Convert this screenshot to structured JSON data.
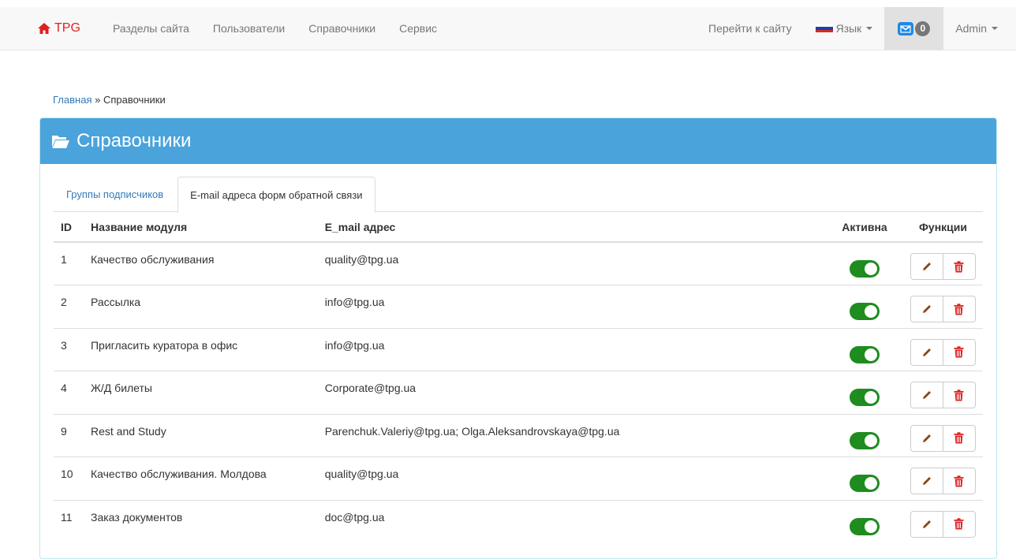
{
  "nav": {
    "brand": "TPG",
    "left_items": [
      "Разделы сайта",
      "Пользователи",
      "Справочники",
      "Сервис"
    ],
    "goto_site": "Перейти к сайту",
    "language": "Язык",
    "messages_count": "0",
    "user": "Admin"
  },
  "breadcrumb": {
    "home": "Главная",
    "separator": "»",
    "current": "Справочники"
  },
  "panel": {
    "title": "Справочники"
  },
  "tabs": [
    {
      "label": "Группы подписчиков",
      "active": false
    },
    {
      "label": "E-mail адреса форм обратной связи",
      "active": true
    }
  ],
  "table": {
    "headers": {
      "id": "ID",
      "module": "Название модуля",
      "email": "E_mail адрес",
      "active": "Активна",
      "functions": "Функции"
    },
    "rows": [
      {
        "id": "1",
        "module": "Качество обслуживания",
        "email": "quality@tpg.ua",
        "active": true
      },
      {
        "id": "2",
        "module": "Рассылка",
        "email": "info@tpg.ua",
        "active": true
      },
      {
        "id": "3",
        "module": "Пригласить куратора в офис",
        "email": "info@tpg.ua",
        "active": true
      },
      {
        "id": "4",
        "module": "Ж/Д билеты",
        "email": "Corporate@tpg.ua",
        "active": true
      },
      {
        "id": "9",
        "module": "Rest and Study",
        "email": "Parenchuk.Valeriy@tpg.ua; Olga.Aleksandrovskaya@tpg.ua",
        "active": true
      },
      {
        "id": "10",
        "module": "Качество обслуживания. Молдова",
        "email": "quality@tpg.ua",
        "active": true
      },
      {
        "id": "11",
        "module": "Заказ документов",
        "email": "doc@tpg.ua",
        "active": true
      }
    ]
  },
  "icons": {
    "brand": "home-icon",
    "panel": "folder-open-icon",
    "messages": "envelope-icon",
    "edit": "pencil-icon",
    "delete": "trash-icon"
  },
  "colors": {
    "brand": "#e02020",
    "panel_heading": "#4aa3db",
    "toggle_on": "#1e8c1e",
    "edit_icon": "#8b4513",
    "delete_icon": "#e02020",
    "link": "#337ab7"
  }
}
